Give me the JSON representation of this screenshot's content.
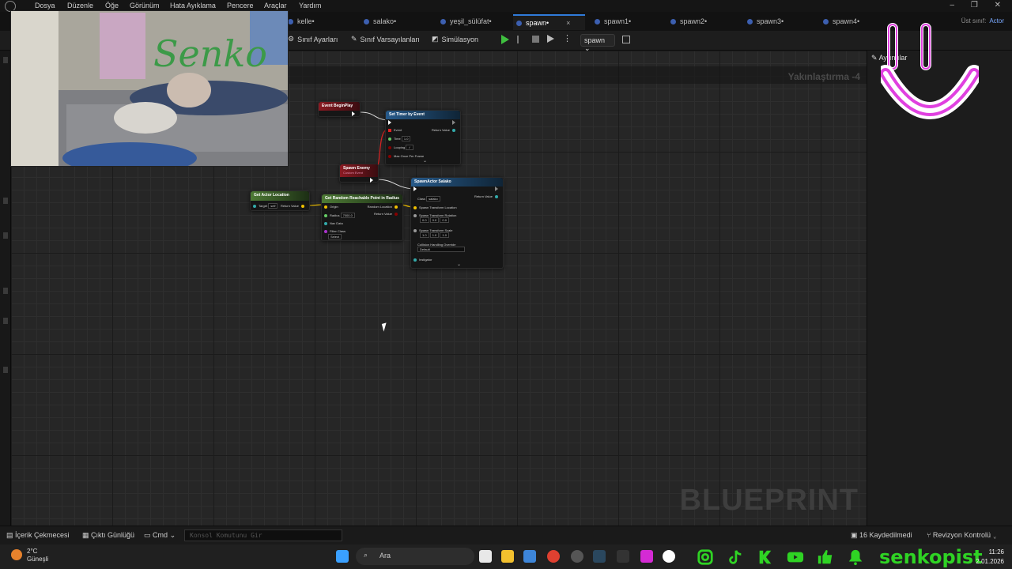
{
  "menu": [
    "Dosya",
    "Düzenle",
    "Öğe",
    "Görünüm",
    "Hata Ayıklama",
    "Pencere",
    "Araçlar",
    "Yardım"
  ],
  "tabs": [
    {
      "label": "kelle•"
    },
    {
      "label": "salako•"
    },
    {
      "label": "yeşil_sülüfat•"
    },
    {
      "label": "spawn•",
      "active": true,
      "close": "×"
    },
    {
      "label": "spawn1•"
    },
    {
      "label": "spawn2•"
    },
    {
      "label": "spawn3•"
    },
    {
      "label": "spawn4•"
    }
  ],
  "parent_class": {
    "label": "Üst sınıf:",
    "value": "Actor"
  },
  "toolbar": {
    "class_settings": "Sınıf Ayarları",
    "class_defaults": "Sınıf Varsayılanları",
    "simulation": "Simülasyon",
    "debug_object": "spawn"
  },
  "graph": {
    "zoom": "Yakınlaştırma -4",
    "watermark": "BLUEPRINT"
  },
  "nodes": {
    "begin_play": {
      "title": "Event BeginPlay"
    },
    "set_timer": {
      "title": "Set Timer by Event",
      "event": "Event",
      "time_label": "Time",
      "time": "1.0",
      "looping": "Looping",
      "max_once": "Max Once Per Frame",
      "return": "Return Value"
    },
    "spawn_enemy": {
      "title": "Spawn Enemy",
      "subtitle": "Custom Event"
    },
    "get_actor_location": {
      "title": "Get Actor Location",
      "subtitle": "Target is Actor",
      "target": "Target",
      "self": "self",
      "return": "Return Value"
    },
    "random_point": {
      "title": "Get Random Reachable Point in Radius",
      "origin": "Origin",
      "radius": "Radius",
      "radius_value": "7000.0",
      "nav_data": "Nav Data",
      "filter": "Filter Class",
      "filter_value": "Select",
      "random_location": "Random Location",
      "return": "Return Value"
    },
    "spawn_actor": {
      "title": "SpawnActor Salako",
      "class_label": "Class",
      "class_value": "salako",
      "return": "Return Value",
      "location": "Spawn Transform Location",
      "rotation": "Spawn Transform Rotation",
      "rot": [
        "0.0",
        "0.0",
        "0.0"
      ],
      "scale": "Spawn Transform Scale",
      "scl": [
        "1.0",
        "1.0",
        "1.0"
      ],
      "collision": "Collision Handling Override",
      "collision_value": "Default",
      "instigator": "Instigator"
    }
  },
  "details": {
    "tab": "Ayrıntılar"
  },
  "bottombar": {
    "content_drawer": "İçerik Çekmecesi",
    "output_log": "Çıktı Günlüğü",
    "cmd": "Cmd",
    "console_placeholder": "Konsol Komutunu Gir",
    "unsaved": "16 Kaydedilmedi",
    "revision": "Revizyon Kontrolü"
  },
  "taskbar": {
    "temp": "2°C",
    "weather": "Güneşli",
    "search": "Ara",
    "time": "11:26",
    "date": "2.01.2026",
    "handle": "senkopist"
  },
  "colors": {
    "accent": "#2f7ad8",
    "event_node": "#8b1a22",
    "func_node": "#275a8a",
    "pure_node": "#4d7a35",
    "social_green": "#2fd324",
    "smiley": "#e040e0"
  }
}
